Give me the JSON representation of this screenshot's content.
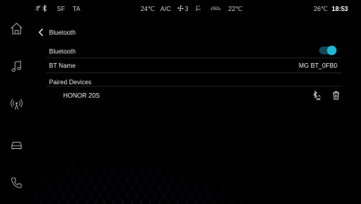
{
  "status_bar": {
    "connectivity_icons": [
      "wifi-off-icon",
      "bluetooth-icon"
    ],
    "sf_label": "SF",
    "ta_label": "TA",
    "cabin_temp": "24℃",
    "ac_label": "A/C",
    "fan_level": "3",
    "seat_temp": "22℃",
    "outside_temp": "26℃",
    "time": "18:53"
  },
  "sidebar": {
    "items": [
      {
        "icon": "home-icon"
      },
      {
        "icon": "music-note-icon"
      },
      {
        "icon": "radio-signal-icon"
      },
      {
        "icon": "car-icon"
      },
      {
        "icon": "phone-icon"
      }
    ]
  },
  "header": {
    "title": "Bluetooth"
  },
  "settings": {
    "bluetooth_label": "Bluetooth",
    "bluetooth_enabled": true,
    "bt_name_label": "BT Name",
    "bt_name_value": "MG BT_0FB0",
    "paired_devices_label": "Paired Devices"
  },
  "paired_devices": [
    {
      "name": "HONOR 20S",
      "actions": [
        "disconnect-icon",
        "delete-icon"
      ]
    }
  ],
  "colors": {
    "accent": "#1fb8d4",
    "background": "#000000",
    "text": "#e8e8e8"
  }
}
